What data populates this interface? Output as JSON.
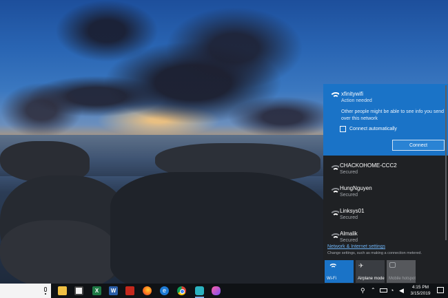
{
  "flyout": {
    "active_network": {
      "name": "xfinitywifi",
      "status": "Action needed",
      "warning": "Other people might be able to see info you send over this network",
      "checkbox_label": "Connect automatically",
      "connect_label": "Connect"
    },
    "networks": [
      {
        "name": "CHACKOHOME-CCC2",
        "status": "Secured"
      },
      {
        "name": "HungNguyen",
        "status": "Secured"
      },
      {
        "name": "Linksys01",
        "status": "Secured"
      },
      {
        "name": "Almalik",
        "status": "Secured"
      }
    ],
    "settings_link": "Network & Internet settings",
    "settings_sub": "Change settings, such as making a connection metered.",
    "quick_actions": [
      {
        "label": "Wi-Fi",
        "icon": "wifi-icon",
        "state": "on"
      },
      {
        "label": "Airplane mode",
        "icon": "airplane-icon",
        "state": "off"
      },
      {
        "label": "Mobile hotspot",
        "icon": "hotspot-icon",
        "state": "disabled"
      }
    ]
  },
  "taskbar": {
    "apps": [
      {
        "name": "File Explorer",
        "icon": "folder-icon"
      },
      {
        "name": "Microsoft Store",
        "icon": "store-icon"
      },
      {
        "name": "Excel",
        "icon": "excel-icon",
        "glyph": "X"
      },
      {
        "name": "Word",
        "icon": "word-icon",
        "glyph": "W"
      },
      {
        "name": "Acrobat",
        "icon": "acrobat-icon"
      },
      {
        "name": "Firefox",
        "icon": "firefox-icon"
      },
      {
        "name": "Edge",
        "icon": "edge-icon",
        "glyph": "e"
      },
      {
        "name": "Chrome",
        "icon": "chrome-icon"
      },
      {
        "name": "App",
        "icon": "app-icon"
      },
      {
        "name": "Paint 3D",
        "icon": "paint-icon"
      }
    ],
    "clock": {
      "time": "4:15 PM",
      "date": "3/15/2019"
    }
  },
  "colors": {
    "accent": "#1a73c7",
    "flyout_bg": "#1f2124",
    "link": "#6eb3f5"
  }
}
